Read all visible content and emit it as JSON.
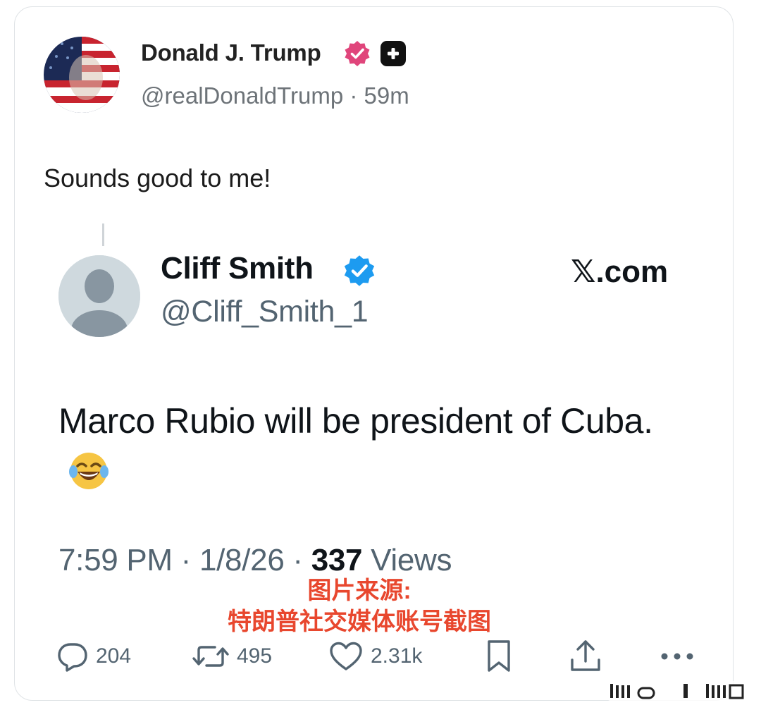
{
  "post": {
    "display_name": "Donald J. Trump",
    "handle_line": "@realDonaldTrump · 59m",
    "text": "Sounds good to me!",
    "icons": {
      "avatar": "avatar-flag-portrait",
      "verified": "pink-verified-badge-icon",
      "plus": "plus-badge-icon"
    }
  },
  "quoted": {
    "display_name": "Cliff Smith",
    "handle": "@Cliff_Smith_1",
    "site_label": "𝕏.com",
    "text": "Marco Rubio will be president of Cuba.",
    "emoji": "face-with-tears-of-joy-emoji",
    "time": "7:59 PM · 1/8/26 · ",
    "views_count": "337",
    "views_label": " Views"
  },
  "caption": {
    "line1": "图片来源:",
    "line2": "特朗普社交媒体账号截图"
  },
  "actions": {
    "replies": "204",
    "reposts": "495",
    "likes": "2.31k"
  },
  "colors": {
    "verified_blue": "#1d9bf0",
    "verified_pink": "#e0457b",
    "caption_red": "#e8472e",
    "muted": "#536471"
  }
}
